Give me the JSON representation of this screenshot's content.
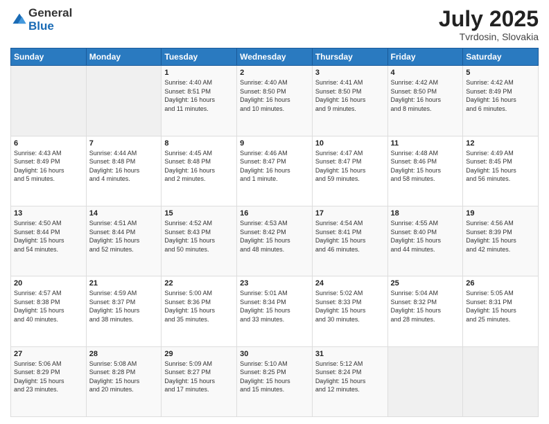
{
  "logo": {
    "general": "General",
    "blue": "Blue"
  },
  "header": {
    "month": "July 2025",
    "location": "Tvrdosin, Slovakia"
  },
  "weekdays": [
    "Sunday",
    "Monday",
    "Tuesday",
    "Wednesday",
    "Thursday",
    "Friday",
    "Saturday"
  ],
  "weeks": [
    [
      {
        "day": "",
        "info": ""
      },
      {
        "day": "",
        "info": ""
      },
      {
        "day": "1",
        "info": "Sunrise: 4:40 AM\nSunset: 8:51 PM\nDaylight: 16 hours\nand 11 minutes."
      },
      {
        "day": "2",
        "info": "Sunrise: 4:40 AM\nSunset: 8:50 PM\nDaylight: 16 hours\nand 10 minutes."
      },
      {
        "day": "3",
        "info": "Sunrise: 4:41 AM\nSunset: 8:50 PM\nDaylight: 16 hours\nand 9 minutes."
      },
      {
        "day": "4",
        "info": "Sunrise: 4:42 AM\nSunset: 8:50 PM\nDaylight: 16 hours\nand 8 minutes."
      },
      {
        "day": "5",
        "info": "Sunrise: 4:42 AM\nSunset: 8:49 PM\nDaylight: 16 hours\nand 6 minutes."
      }
    ],
    [
      {
        "day": "6",
        "info": "Sunrise: 4:43 AM\nSunset: 8:49 PM\nDaylight: 16 hours\nand 5 minutes."
      },
      {
        "day": "7",
        "info": "Sunrise: 4:44 AM\nSunset: 8:48 PM\nDaylight: 16 hours\nand 4 minutes."
      },
      {
        "day": "8",
        "info": "Sunrise: 4:45 AM\nSunset: 8:48 PM\nDaylight: 16 hours\nand 2 minutes."
      },
      {
        "day": "9",
        "info": "Sunrise: 4:46 AM\nSunset: 8:47 PM\nDaylight: 16 hours\nand 1 minute."
      },
      {
        "day": "10",
        "info": "Sunrise: 4:47 AM\nSunset: 8:47 PM\nDaylight: 15 hours\nand 59 minutes."
      },
      {
        "day": "11",
        "info": "Sunrise: 4:48 AM\nSunset: 8:46 PM\nDaylight: 15 hours\nand 58 minutes."
      },
      {
        "day": "12",
        "info": "Sunrise: 4:49 AM\nSunset: 8:45 PM\nDaylight: 15 hours\nand 56 minutes."
      }
    ],
    [
      {
        "day": "13",
        "info": "Sunrise: 4:50 AM\nSunset: 8:44 PM\nDaylight: 15 hours\nand 54 minutes."
      },
      {
        "day": "14",
        "info": "Sunrise: 4:51 AM\nSunset: 8:44 PM\nDaylight: 15 hours\nand 52 minutes."
      },
      {
        "day": "15",
        "info": "Sunrise: 4:52 AM\nSunset: 8:43 PM\nDaylight: 15 hours\nand 50 minutes."
      },
      {
        "day": "16",
        "info": "Sunrise: 4:53 AM\nSunset: 8:42 PM\nDaylight: 15 hours\nand 48 minutes."
      },
      {
        "day": "17",
        "info": "Sunrise: 4:54 AM\nSunset: 8:41 PM\nDaylight: 15 hours\nand 46 minutes."
      },
      {
        "day": "18",
        "info": "Sunrise: 4:55 AM\nSunset: 8:40 PM\nDaylight: 15 hours\nand 44 minutes."
      },
      {
        "day": "19",
        "info": "Sunrise: 4:56 AM\nSunset: 8:39 PM\nDaylight: 15 hours\nand 42 minutes."
      }
    ],
    [
      {
        "day": "20",
        "info": "Sunrise: 4:57 AM\nSunset: 8:38 PM\nDaylight: 15 hours\nand 40 minutes."
      },
      {
        "day": "21",
        "info": "Sunrise: 4:59 AM\nSunset: 8:37 PM\nDaylight: 15 hours\nand 38 minutes."
      },
      {
        "day": "22",
        "info": "Sunrise: 5:00 AM\nSunset: 8:36 PM\nDaylight: 15 hours\nand 35 minutes."
      },
      {
        "day": "23",
        "info": "Sunrise: 5:01 AM\nSunset: 8:34 PM\nDaylight: 15 hours\nand 33 minutes."
      },
      {
        "day": "24",
        "info": "Sunrise: 5:02 AM\nSunset: 8:33 PM\nDaylight: 15 hours\nand 30 minutes."
      },
      {
        "day": "25",
        "info": "Sunrise: 5:04 AM\nSunset: 8:32 PM\nDaylight: 15 hours\nand 28 minutes."
      },
      {
        "day": "26",
        "info": "Sunrise: 5:05 AM\nSunset: 8:31 PM\nDaylight: 15 hours\nand 25 minutes."
      }
    ],
    [
      {
        "day": "27",
        "info": "Sunrise: 5:06 AM\nSunset: 8:29 PM\nDaylight: 15 hours\nand 23 minutes."
      },
      {
        "day": "28",
        "info": "Sunrise: 5:08 AM\nSunset: 8:28 PM\nDaylight: 15 hours\nand 20 minutes."
      },
      {
        "day": "29",
        "info": "Sunrise: 5:09 AM\nSunset: 8:27 PM\nDaylight: 15 hours\nand 17 minutes."
      },
      {
        "day": "30",
        "info": "Sunrise: 5:10 AM\nSunset: 8:25 PM\nDaylight: 15 hours\nand 15 minutes."
      },
      {
        "day": "31",
        "info": "Sunrise: 5:12 AM\nSunset: 8:24 PM\nDaylight: 15 hours\nand 12 minutes."
      },
      {
        "day": "",
        "info": ""
      },
      {
        "day": "",
        "info": ""
      }
    ]
  ]
}
